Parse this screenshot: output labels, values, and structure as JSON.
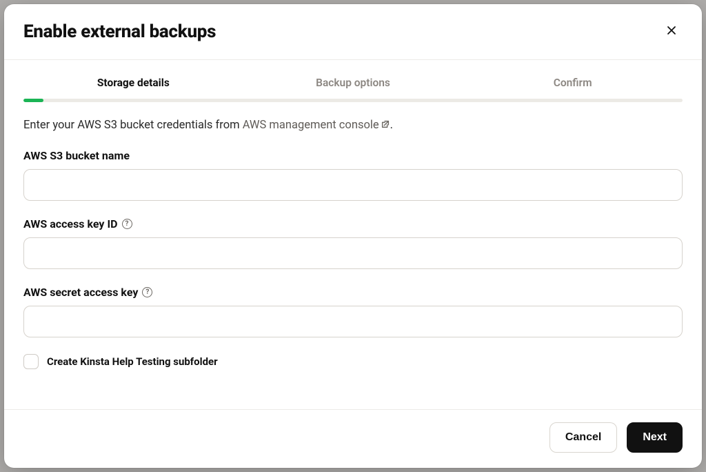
{
  "modal": {
    "title": "Enable external backups"
  },
  "steps": {
    "items": [
      {
        "label": "Storage details"
      },
      {
        "label": "Backup options"
      },
      {
        "label": "Confirm"
      }
    ],
    "progress_percent": 3
  },
  "intro": {
    "prefix": "Enter your AWS S3 bucket credentials from ",
    "link_text": "AWS management console",
    "suffix": "."
  },
  "fields": {
    "bucket_name": {
      "label": "AWS S3 bucket name",
      "value": ""
    },
    "access_key_id": {
      "label": "AWS access key ID",
      "value": ""
    },
    "secret_access_key": {
      "label": "AWS secret access key",
      "value": ""
    }
  },
  "checkbox": {
    "label": "Create Kinsta Help Testing subfolder",
    "checked": false
  },
  "footer": {
    "cancel": "Cancel",
    "next": "Next"
  }
}
